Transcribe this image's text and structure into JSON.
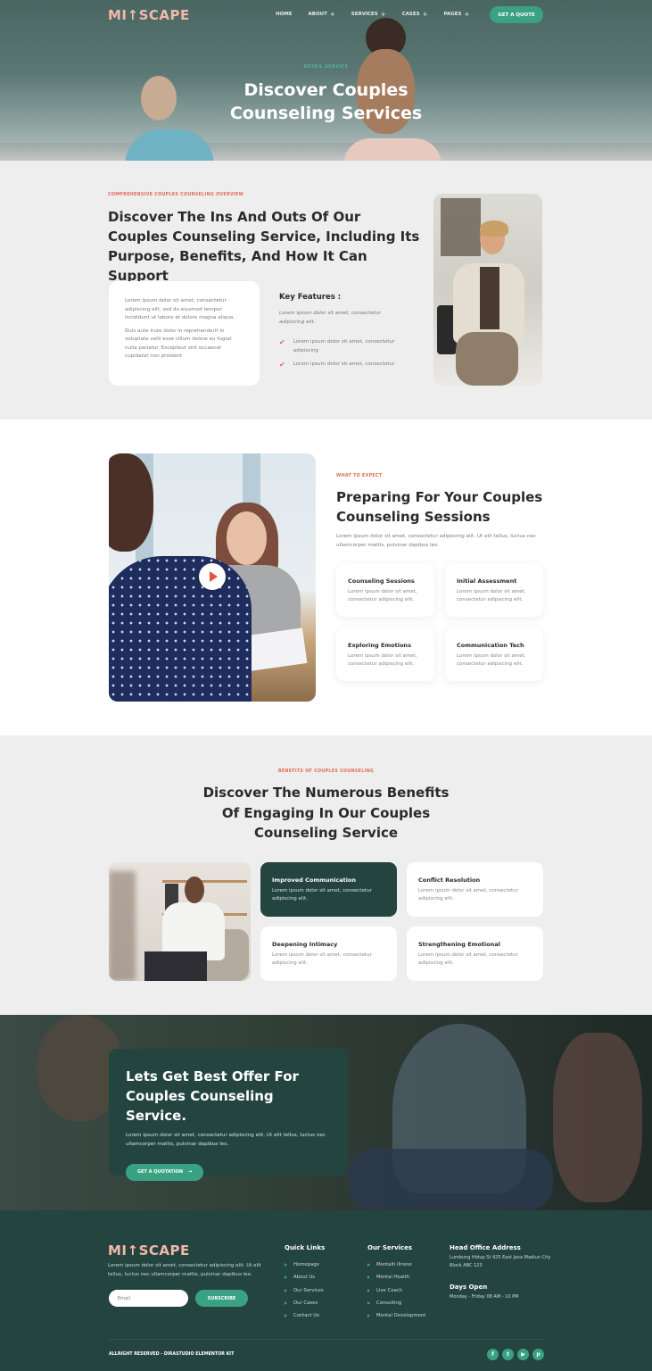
{
  "brand": {
    "logo": "MI↑SCAPE",
    "accent": "#3aa282",
    "dark": "#244440",
    "coral": "#e06c55",
    "logo_color": "#f3b8a9"
  },
  "header": {
    "nav": [
      {
        "label": "HOME",
        "has_plus": false
      },
      {
        "label": "ABOUT",
        "has_plus": true
      },
      {
        "label": "SERVICES",
        "has_plus": true
      },
      {
        "label": "CASES",
        "has_plus": true
      },
      {
        "label": "PAGES",
        "has_plus": true
      }
    ],
    "plus": "+",
    "cta": "GET A QUOTE"
  },
  "hero": {
    "tag": "RETAIL SERVICE",
    "title_line1": "Discover Couples",
    "title_line2": "Counseling Services"
  },
  "overview": {
    "eyebrow": "COMPREHENSIVE COUPLES COUNSELING OVERVIEW",
    "title": "Discover The Ins And Outs Of Our Couples Counseling Service, Including Its Purpose, Benefits, And How It Can Support",
    "card_paragraphs": [
      "Lorem ipsum dolor sit amet, consectetur adipiscing elit, sed do eiusmod tempor incididunt ut labore et dolore magna aliqua.",
      "Duis aute irure dolor in reprehenderit in voluptate velit esse cillum dolore eu fugiat nulla pariatur. Excepteur sint occaecat cupidatat non proident"
    ],
    "key_features_title": "Key Features :",
    "key_features_intro": "Lorem ipsum dolor sit amet, consectetur adipiscing elit.",
    "features": [
      "Lorem ipsum dolor sit amet, consectetur adipiscing",
      "Lorem ipsum dolor sit amet, consectetur"
    ],
    "check_icon": "✔"
  },
  "expect": {
    "eyebrow": "WHAT TO EXPECT",
    "title": "Preparing For Your Couples Counseling Sessions",
    "description": "Lorem ipsum dolor sit amet, consectetur adipiscing elit. Ut elit tellus, luctus nec ullamcorper mattis, pulvinar dapibus leo.",
    "cards": [
      {
        "title": "Counseling Sessions",
        "text": "Lorem ipsum dolor sit amet, consectetur adipiscing elit."
      },
      {
        "title": "Initial Assessment",
        "text": "Lorem ipsum dolor sit amet, consectetur adipiscing elit."
      },
      {
        "title": "Exploring Emotions",
        "text": "Lorem ipsum dolor sit amet, consectetur adipiscing elit."
      },
      {
        "title": "Communication Tech",
        "text": "Lorem ipsum dolor sit amet, consectetur adipiscing elit."
      }
    ]
  },
  "benefits": {
    "eyebrow": "BENEFITS OF COUPLES COUNSELING",
    "title_line1": "Discover The Numerous Benefits",
    "title_line2": "Of Engaging In Our Couples",
    "title_line3": "Counseling Service",
    "cards": [
      {
        "title": "Improved Communication",
        "text": "Lorem ipsum dolor sit amet, consectetur adipiscing elit.",
        "highlighted": true
      },
      {
        "title": "Conflict Resolution",
        "text": "Lorem ipsum dolor sit amet, consectetur adipiscing elit.",
        "highlighted": false
      },
      {
        "title": "Deepening Intimacy",
        "text": "Lorem ipsum dolor sit amet, consectetur adipiscing elit.",
        "highlighted": false
      },
      {
        "title": "Strengthening Emotional",
        "text": "Lorem ipsum dolor sit amet, consectetur adipiscing elit.",
        "highlighted": false
      }
    ]
  },
  "offer": {
    "title_line1": "Lets Get Best Offer For",
    "title_line2": "Couples Counseling Service.",
    "description": "Lorem ipsum dolor sit amet, consectetur adipiscing elit. Ut elit tellus, luctus nec ullamcorper mattis, pulvinar dapibus leo.",
    "button": "GET A QUOTATION",
    "button_arrow": "→"
  },
  "footer": {
    "logo": "MI↑SCAPE",
    "description": "Lorem ipsum dolor sit amet, consectetur adipiscing elit. Ut elit tellus, luctus nec ullamcorper mattis, pulvinar dapibus leo.",
    "email_placeholder": "Email",
    "subscribe": "SUBSCRIBE",
    "quick_links": {
      "title": "Quick Links",
      "items": [
        "Homepage",
        "About Us",
        "Our Services",
        "Our Cases",
        "Contact Us"
      ]
    },
    "services": {
      "title": "Our Services",
      "items": [
        "Mentalh Illness",
        "Mental Health",
        "Live Coach",
        "Consulting",
        "Mental Development"
      ]
    },
    "address": {
      "title": "Head Office Address",
      "text": "Lumbung Hidup St 425 East Java Madiun City Block ABC 123"
    },
    "hours": {
      "title": "Days Open",
      "text": "Monday - Friday 08 AM - 10 PM"
    },
    "copyright": "ALLRIGHT RESERVED - DIRASTUDIO ELEMENTOR KIT",
    "socials": [
      {
        "name": "facebook",
        "glyph": "f"
      },
      {
        "name": "twitter",
        "glyph": "t"
      },
      {
        "name": "youtube",
        "glyph": "▶"
      },
      {
        "name": "pinterest",
        "glyph": "p"
      }
    ]
  }
}
